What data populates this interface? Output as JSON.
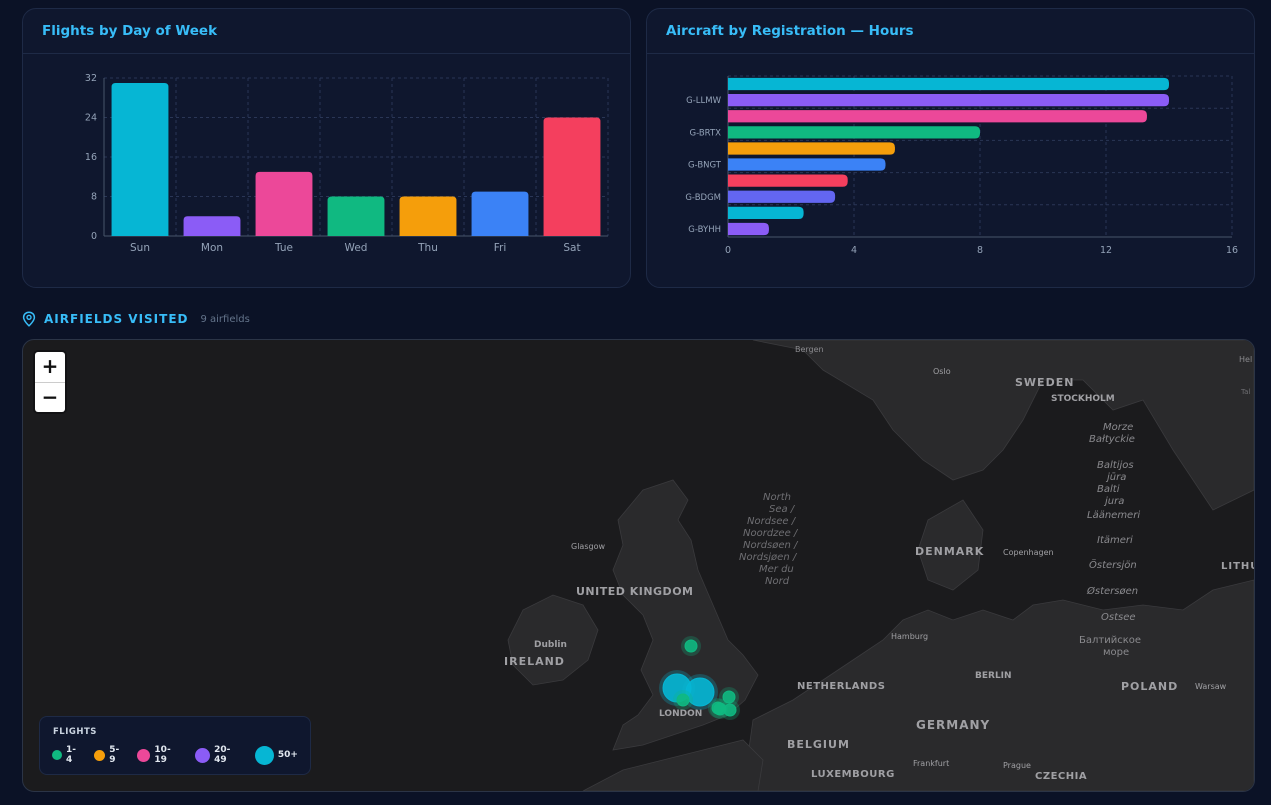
{
  "days_card": {
    "title": "Flights by Day of Week"
  },
  "reg_card": {
    "title": "Aircraft by Registration — Hours"
  },
  "chart_data": [
    {
      "type": "bar",
      "title": "Flights by Day of Week",
      "categories": [
        "Sun",
        "Mon",
        "Tue",
        "Wed",
        "Thu",
        "Fri",
        "Sat"
      ],
      "values": [
        31,
        4,
        13,
        8,
        8,
        9,
        24
      ],
      "colors": [
        "#06b6d4",
        "#8b5cf6",
        "#ec4899",
        "#10b981",
        "#f59e0b",
        "#3b82f6",
        "#f43f5e"
      ],
      "ylim": [
        0,
        32
      ],
      "yticks": [
        "0",
        "8",
        "16",
        "24",
        "32"
      ],
      "grid": true,
      "orientation": "vertical"
    },
    {
      "type": "bar",
      "title": "Aircraft by Registration — Hours",
      "orientation": "horizontal",
      "values": [
        14,
        14,
        13.3,
        8,
        5.3,
        5,
        3.8,
        3.4,
        2.4,
        1.3
      ],
      "colors": [
        "#06b6d4",
        "#8b5cf6",
        "#ec4899",
        "#10b981",
        "#f59e0b",
        "#3b82f6",
        "#f43f5e",
        "#6366f1",
        "#06b6d4",
        "#8b5cf6"
      ],
      "labels": [
        "",
        "G-LLMW",
        "",
        "G-BRTX",
        "",
        "G-BNGT",
        "",
        "G-BDGM",
        "",
        "G-BYHH"
      ],
      "xlim": [
        0,
        16
      ],
      "xticks": [
        "0",
        "4",
        "8",
        "12",
        "16"
      ],
      "grid": true
    }
  ],
  "airfields": {
    "title": "AIRFIELDS VISITED",
    "count": "9 airfields",
    "icon": "map-pin-icon"
  },
  "map": {
    "zoom_in": "+",
    "zoom_out": "−",
    "labels": [
      "Bergen",
      "Oslo",
      "SWEDEN",
      "STOCKHOLM",
      "Morze",
      "Bałtyckie",
      "Baltijos",
      "jūra",
      "Balti",
      "jura",
      "Läänemeri",
      "Itämeri",
      "Östersjön",
      "Østersøen",
      "Ostsee",
      "Балтийское",
      "море",
      "North",
      "Sea /",
      "Nordsee /",
      "Noordzee /",
      "Nordsøen /",
      "Nordsjøen /",
      "Mer du",
      "Nord",
      "Glasgow",
      "UNITED KINGDOM",
      "DENMARK",
      "Copenhagen",
      "Dublin",
      "IRELAND",
      "Hamburg",
      "BERLIN",
      "NETHERLANDS",
      "POLAND",
      "Warsaw",
      "LONDON",
      "GERMANY",
      "BELGIUM",
      "LUXEMBOURG",
      "Frankfurt",
      "Prague",
      "CZECHIA",
      "LITHU",
      "Hel",
      "Tal"
    ],
    "markers": [
      {
        "flights": 2,
        "band": "1-4"
      },
      {
        "flights": 60,
        "band": "50+"
      },
      {
        "flights": 55,
        "band": "50+"
      },
      {
        "flights": 2,
        "band": "1-4"
      },
      {
        "flights": 2,
        "band": "1-4"
      },
      {
        "flights": 2,
        "band": "1-4"
      },
      {
        "flights": 1,
        "band": "1-4"
      },
      {
        "flights": 1,
        "band": "1-4"
      }
    ]
  },
  "legend": {
    "title": "FLIGHTS",
    "items": [
      {
        "label": "1-4",
        "color": "#10b981"
      },
      {
        "label": "5-9",
        "color": "#f59e0b"
      },
      {
        "label": "10-19",
        "color": "#ec4899"
      },
      {
        "label": "20-49",
        "color": "#8b5cf6"
      },
      {
        "label": "50+",
        "color": "#06b6d4"
      }
    ]
  }
}
